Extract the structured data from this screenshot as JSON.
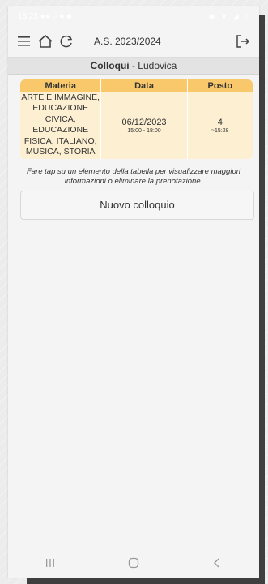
{
  "statusbar": {
    "time": "18:23",
    "left_icons": "●● ○ ● ■ ·",
    "right_icons": "◉ ▼ ◢ ▯"
  },
  "toolbar": {
    "title": "A.S. 2023/2024",
    "icons": [
      "menu-icon",
      "home-icon",
      "refresh-icon",
      "logout-icon"
    ]
  },
  "subheader": {
    "bold": "Colloqui",
    "rest": " - Ludovica"
  },
  "table": {
    "headers": [
      "Materia",
      "Data",
      "Posto"
    ],
    "rows": [
      {
        "materia": "ARTE E IMMAGINE, EDUCAZIONE CIVICA, EDUCAZIONE FISICA, ITALIANO, MUSICA, STORIA",
        "data": "06/12/2023",
        "orario": "15:00 - 18:00",
        "posto": "4",
        "ora_stimata": "≈15:28"
      }
    ]
  },
  "info_text": "Fare tap su un elemento della tabella per visualizzare maggiori informazioni o eliminare la prenotazione.",
  "new_button": "Nuovo colloquio",
  "colors": {
    "header_bg": "#f9c86b",
    "row_bg": "#fdefd2"
  }
}
